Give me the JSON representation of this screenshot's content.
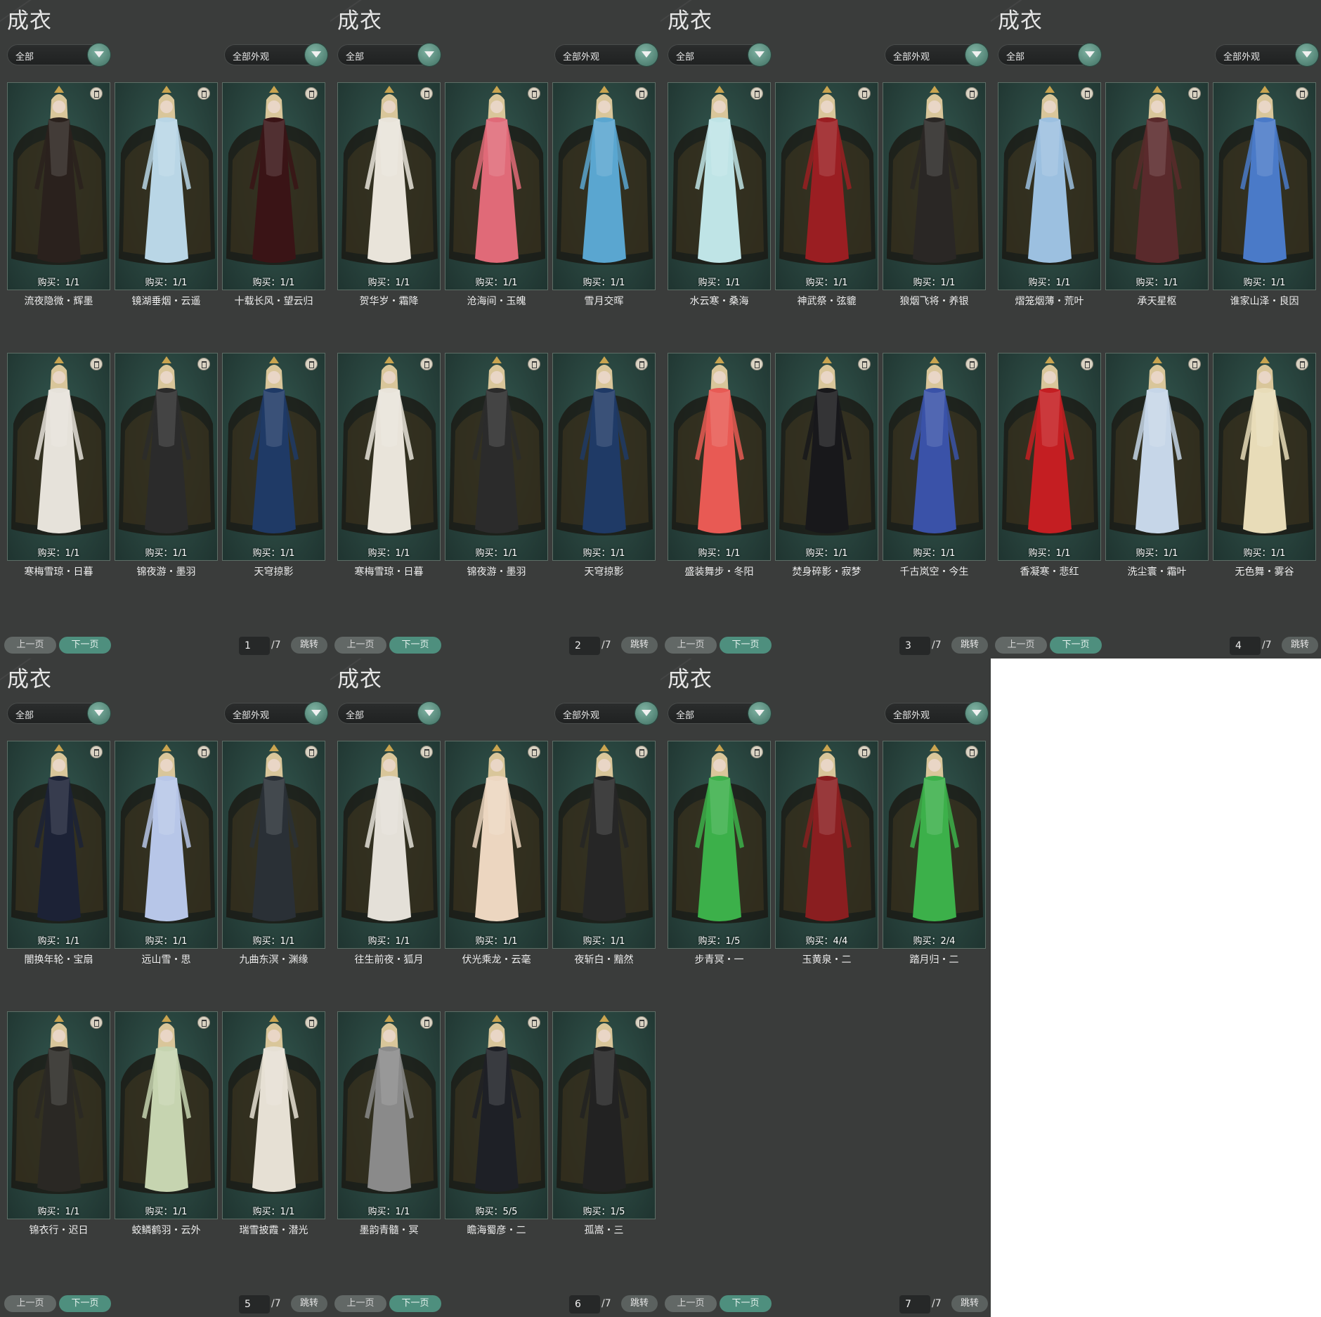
{
  "title": "成衣",
  "filter_left": "全部",
  "filter_right": "全部外观",
  "prev_label": "上一页",
  "next_label": "下一页",
  "jump_label": "跳转",
  "pages": [
    {
      "page": "1",
      "total": "/7",
      "items": [
        {
          "name": "流夜隐微・辉墨",
          "buy": "购买：1/1",
          "color": "#2a211d"
        },
        {
          "name": "镜湖垂烟・云遥",
          "buy": "购买：1/1",
          "color": "#b9d6e6"
        },
        {
          "name": "十载长风・望云归",
          "buy": "购买：1/1",
          "color": "#3a1416"
        },
        {
          "name": "寒梅雪琼・日暮",
          "buy": "购买：1/1",
          "color": "#e6e2da"
        },
        {
          "name": "锦夜游・墨羽",
          "buy": "购买：1/1",
          "color": "#2b2b2b"
        },
        {
          "name": "天穹掠影",
          "buy": "购买：1/1",
          "color": "#1f3a66"
        }
      ]
    },
    {
      "page": "2",
      "total": "/7",
      "items": [
        {
          "name": "贺华岁・霜降",
          "buy": "购买：1/1",
          "color": "#e9e4da"
        },
        {
          "name": "沧海间・玉魄",
          "buy": "购买：1/1",
          "color": "#e06a78"
        },
        {
          "name": "雪月交晖",
          "buy": "购买：1/1",
          "color": "#5aa6d0"
        },
        {
          "name": "寒梅雪琼・日暮",
          "buy": "购买：1/1",
          "color": "#e9e4da"
        },
        {
          "name": "锦夜游・墨羽",
          "buy": "购买：1/1",
          "color": "#2b2b2b"
        },
        {
          "name": "天穹掠影",
          "buy": "购买：1/1",
          "color": "#1f3a66"
        }
      ]
    },
    {
      "page": "3",
      "total": "/7",
      "items": [
        {
          "name": "水云寒・桑海",
          "buy": "购买：1/1",
          "color": "#bfe4e6"
        },
        {
          "name": "神武祭・弦貔",
          "buy": "购买：1/1",
          "color": "#9a1e22"
        },
        {
          "name": "狼烟飞将・养银",
          "buy": "购买：1/1",
          "color": "#2a2725"
        },
        {
          "name": "盛装舞步・冬阳",
          "buy": "购买：1/1",
          "color": "#e85a54"
        },
        {
          "name": "焚身碎影・寂梦",
          "buy": "购买：1/1",
          "color": "#18181b"
        },
        {
          "name": "千古岚空・今生",
          "buy": "购买：1/1",
          "color": "#3a52a8"
        }
      ]
    },
    {
      "page": "4",
      "total": "/7",
      "items": [
        {
          "name": "熠笼烟薄・荒叶",
          "buy": "购买：1/1",
          "color": "#9cc0e0"
        },
        {
          "name": "承天星枢",
          "buy": "购买：1/1",
          "color": "#5a2a2c"
        },
        {
          "name": "谁家山泽・良因",
          "buy": "购买：1/1",
          "color": "#4a7ac8"
        },
        {
          "name": "香凝寒・悲红",
          "buy": "购买：1/1",
          "color": "#c41e22"
        },
        {
          "name": "洗尘寰・霜叶",
          "buy": "购买：1/1",
          "color": "#c6d6e8"
        },
        {
          "name": "无色舞・雾谷",
          "buy": "购买：1/1",
          "color": "#e8dcb8"
        }
      ]
    },
    {
      "page": "5",
      "total": "/7",
      "items": [
        {
          "name": "闇换年轮・宝扇",
          "buy": "购买：1/1",
          "color": "#1c2236"
        },
        {
          "name": "远山雪・思",
          "buy": "购买：1/1",
          "color": "#b7c6e8"
        },
        {
          "name": "九曲东溟・渊缘",
          "buy": "购买：1/1",
          "color": "#2a3036"
        },
        {
          "name": "锦衣行・迟日",
          "buy": "购买：1/1",
          "color": "#2a2824"
        },
        {
          "name": "蛟鳞鹤羽・云外",
          "buy": "购买：1/1",
          "color": "#c6d4b0"
        },
        {
          "name": "瑞雪披霞・潜光",
          "buy": "购买：1/1",
          "color": "#e6e0d4"
        }
      ]
    },
    {
      "page": "6",
      "total": "/7",
      "items": [
        {
          "name": "往生前夜・狐月",
          "buy": "购买：1/1",
          "color": "#e4e0d8"
        },
        {
          "name": "伏光乘龙・云毫",
          "buy": "购买：1/1",
          "color": "#ecd6c0"
        },
        {
          "name": "夜斩白・黯然",
          "buy": "购买：1/1",
          "color": "#262626"
        },
        {
          "name": "墨韵青髓・冥",
          "buy": "购买：1/1",
          "color": "#8a8a8a"
        },
        {
          "name": "瞻海蜀彦・二",
          "buy": "购买：5/5",
          "color": "#1e2026"
        },
        {
          "name": "孤嵩・三",
          "buy": "购买：1/5",
          "color": "#222222"
        }
      ]
    },
    {
      "page": "7",
      "total": "/7",
      "items": [
        {
          "name": "步青冥・一",
          "buy": "购买：1/5",
          "color": "#3cb04a"
        },
        {
          "name": "玉黄泉・二",
          "buy": "购买：4/4",
          "color": "#8a1e20"
        },
        {
          "name": "踏月归・二",
          "buy": "购买：2/4",
          "color": "#3cb04a"
        }
      ]
    }
  ]
}
